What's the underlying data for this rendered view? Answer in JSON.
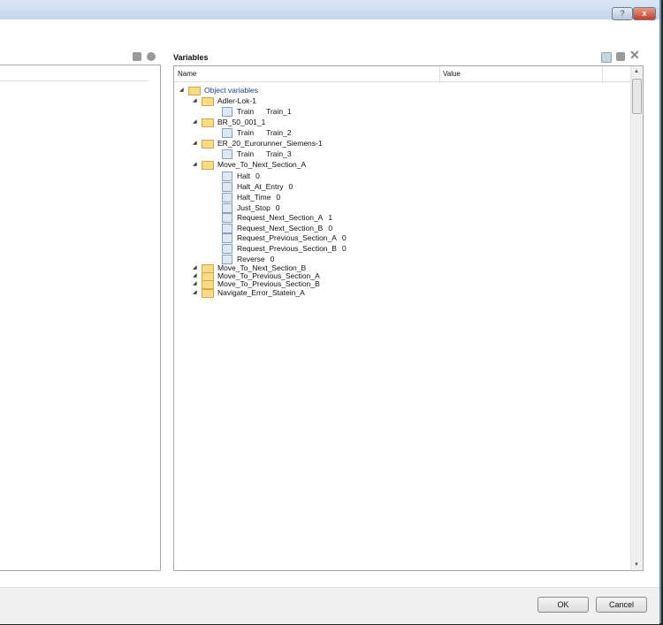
{
  "window": {
    "help_label": "?",
    "close_label": "x"
  },
  "variables_panel": {
    "title": "Variables",
    "columns": {
      "name": "Name",
      "value": "Value"
    }
  },
  "tree": [
    {
      "label": "Object variables",
      "value": "",
      "type": "folder",
      "depth": 0
    },
    {
      "label": "Adler-Lok-1",
      "value": "",
      "type": "folder",
      "depth": 1
    },
    {
      "label": "Train",
      "value": "Train_1",
      "type": "var",
      "depth": 2
    },
    {
      "label": "BR_50_001_1",
      "value": "",
      "type": "folder",
      "depth": 1
    },
    {
      "label": "Train",
      "value": "Train_2",
      "type": "var",
      "depth": 2
    },
    {
      "label": "ER_20_Eurorunner_Siemens-1",
      "value": "",
      "type": "folder",
      "depth": 1
    },
    {
      "label": "Train",
      "value": "Train_3",
      "type": "var",
      "depth": 2
    },
    {
      "label": "Move_To_Next_Section_A",
      "value": "",
      "type": "folder",
      "depth": 1
    },
    {
      "label": "Halt",
      "value": "0",
      "type": "var",
      "depth": 2
    },
    {
      "label": "Halt_At_Entry",
      "value": "0",
      "type": "var",
      "depth": 2
    },
    {
      "label": "Halt_Time",
      "value": "0",
      "type": "var",
      "depth": 2
    },
    {
      "label": "Just_Stop",
      "value": "0",
      "type": "var",
      "depth": 2
    },
    {
      "label": "Request_Next_Section_A",
      "value": "1",
      "type": "var",
      "depth": 2
    },
    {
      "label": "Request_Next_Section_B",
      "value": "0",
      "type": "var",
      "depth": 2
    },
    {
      "label": "Request_Previous_Section_A",
      "value": "0",
      "type": "var",
      "depth": 2
    },
    {
      "label": "Request_Previous_Section_B",
      "value": "0",
      "type": "var",
      "depth": 2
    },
    {
      "label": "Reverse",
      "value": "0",
      "type": "var",
      "depth": 2
    },
    {
      "label": "Move_To_Next_Section_B",
      "value": "",
      "type": "folder",
      "depth": 1
    },
    {
      "label": "Move_To_Previous_Section_A",
      "value": "",
      "type": "folder",
      "depth": 1
    },
    {
      "label": "Move_To_Previous_Section_B",
      "value": "",
      "type": "folder",
      "depth": 1
    },
    {
      "label": "Navigate_Error_Statein_A",
      "value": "",
      "type": "folder",
      "depth": 1
    }
  ],
  "footer": {
    "ok_label": "OK",
    "cancel_label": "Cancel"
  }
}
